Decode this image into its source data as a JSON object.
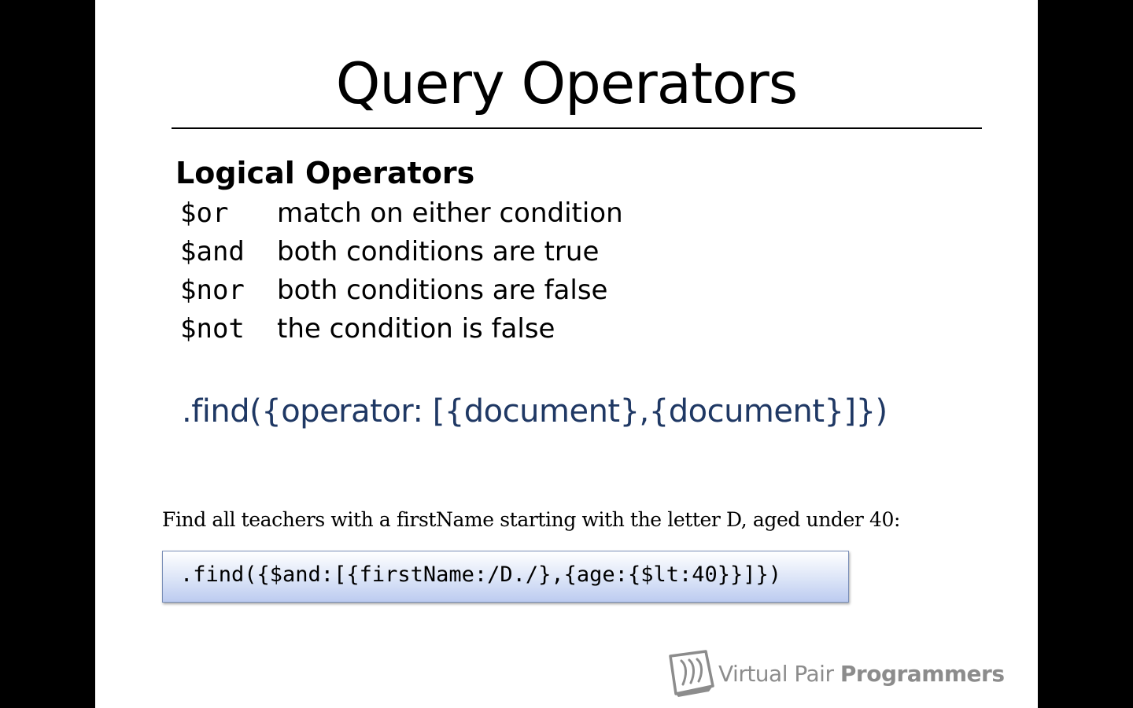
{
  "slide": {
    "title": "Query Operators",
    "section_heading": "Logical Operators",
    "operators": [
      {
        "name": "$or",
        "description": "match on either condition"
      },
      {
        "name": "$and",
        "description": "both conditions are true"
      },
      {
        "name": "$nor",
        "description": "both conditions are false"
      },
      {
        "name": "$not",
        "description": "the condition is false"
      }
    ],
    "syntax": ".find({operator: [{document},{document}]})",
    "example_label": "Find all teachers with a firstName starting with the letter D, aged under 40:",
    "example_code": ".find({$and:[{firstName:/D./},{age:{$lt:40}}]})"
  },
  "logo": {
    "icon": "book-icon",
    "text_light": "Virtual Pair ",
    "text_bold": "Programmers"
  },
  "colors": {
    "background": "#000000",
    "slide": "#ffffff",
    "syntax_text": "#1f3864",
    "logo_text": "#8c8c8c"
  }
}
